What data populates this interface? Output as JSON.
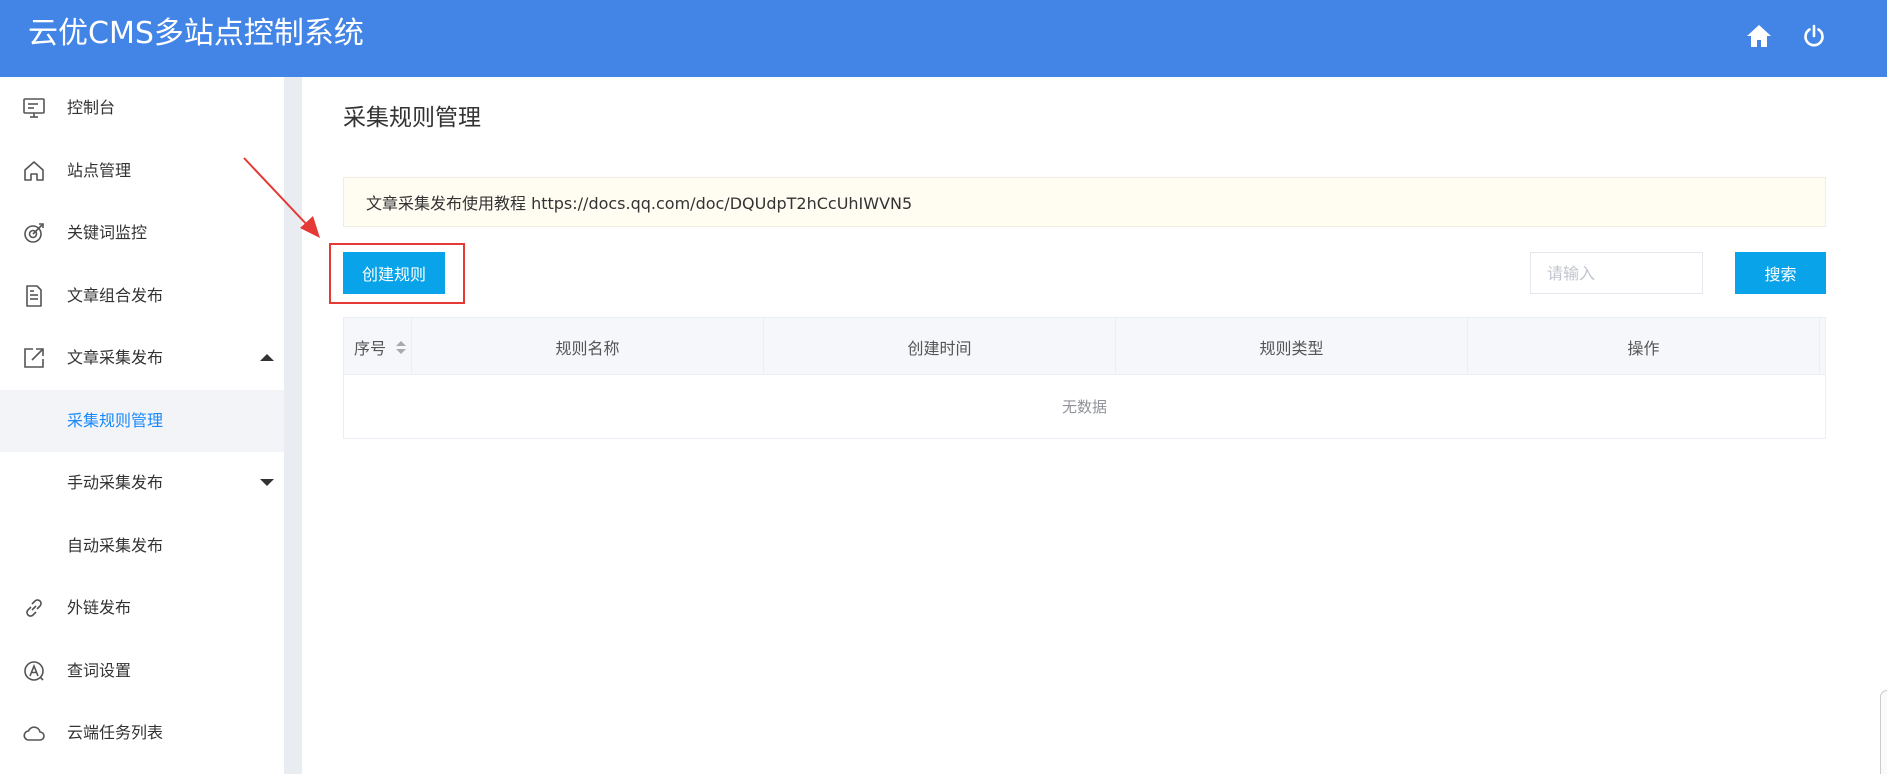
{
  "header": {
    "title": "云优CMS多站点控制系统",
    "icons": [
      "home-icon",
      "power-icon"
    ],
    "color": "#4285e6"
  },
  "sidebar": {
    "items": [
      {
        "label": "控制台",
        "icon": "monitor-icon"
      },
      {
        "label": "站点管理",
        "icon": "home-outline-icon"
      },
      {
        "label": "关键词监控",
        "icon": "target-icon"
      },
      {
        "label": "文章组合发布",
        "icon": "document-icon"
      },
      {
        "label": "文章采集发布",
        "icon": "external-link-icon",
        "expanded": true
      },
      {
        "label": "采集规则管理",
        "active": true
      },
      {
        "label": "手动采集发布",
        "collapsed": true
      },
      {
        "label": "自动采集发布"
      },
      {
        "label": "外链发布",
        "icon": "link-icon"
      },
      {
        "label": "查词设置",
        "icon": "circle-a-icon"
      },
      {
        "label": "云端任务列表",
        "icon": "cloud-icon"
      }
    ]
  },
  "main": {
    "page_title": "采集规则管理",
    "notice": "文章采集发布使用教程 https://docs.qq.com/doc/DQUdpT2hCcUhIWVN5",
    "create_button": "创建规则",
    "search": {
      "placeholder": "请输入",
      "value": "",
      "button": "搜索"
    },
    "table": {
      "columns": [
        "序号",
        "规则名称",
        "创建时间",
        "规则类型",
        "操作"
      ],
      "empty_text": "无数据"
    }
  },
  "accent_color": "#08a3e8",
  "annotation_color": "#e53935"
}
